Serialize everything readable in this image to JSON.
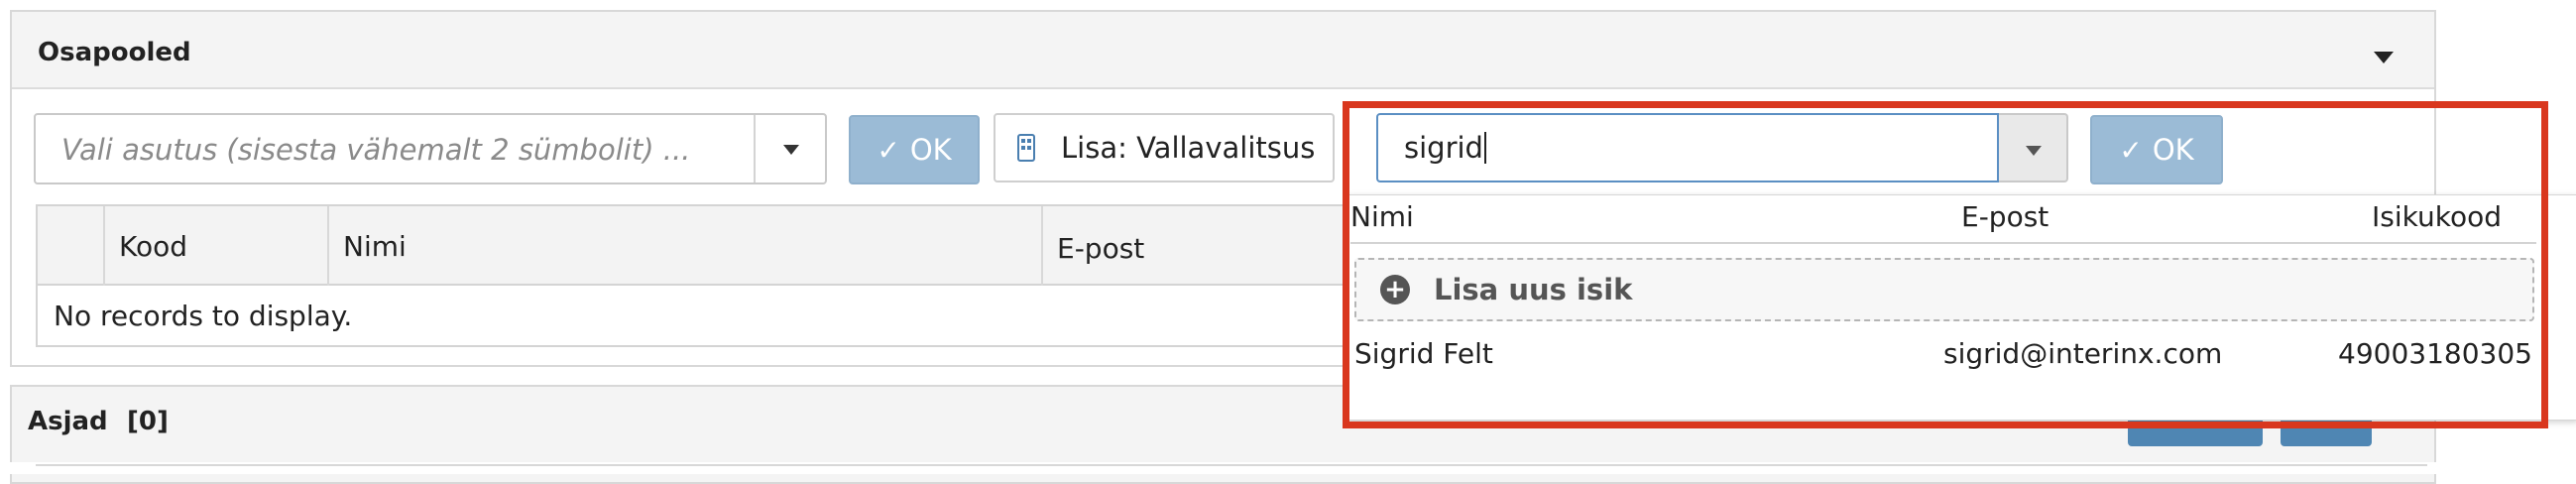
{
  "osapooled": {
    "title": "Osapooled",
    "org_combo": {
      "placeholder": "Vali asutus (sisesta vähemalt 2 sümbolit) ..."
    },
    "ok_label": "OK",
    "add_org_label": "Lisa: Vallavalitsus",
    "table": {
      "columns": [
        "",
        "Kood",
        "Nimi",
        "E-post"
      ],
      "empty_text": "No records to display."
    }
  },
  "person_search": {
    "value": "sigrid",
    "ok_label": "OK",
    "dropdown": {
      "columns": [
        "Nimi",
        "E-post",
        "Isikukood"
      ],
      "add_label": "Lisa uus isik",
      "results": [
        {
          "name": "Sigrid Felt",
          "email": "sigrid@interinx.com",
          "id_code": "49003180305"
        }
      ]
    }
  },
  "asjad": {
    "title": "Asjad",
    "count": "[0]"
  },
  "colors": {
    "highlight_frame": "#d9371e",
    "ok_button_bg": "#9bbbd6",
    "focus_border": "#5b8fc3"
  }
}
